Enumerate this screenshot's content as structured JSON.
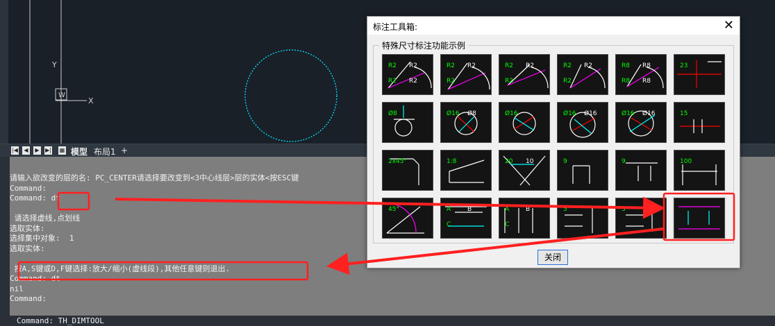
{
  "canvas": {
    "axis_y_label": "Y",
    "axis_x_label": "X",
    "ucs_label": "W",
    "entity_color": "#00e5ff"
  },
  "tabs": {
    "model": "模型",
    "layout1": "布局1",
    "add": "+"
  },
  "command_history": [
    "请输入欲改变的层的名: PC_CENTER请选择要改变到<3中心线层>层的实体<按ESC键",
    "Command:",
    "Command: dt",
    "",
    " 请选择虚线,点划线",
    "选取实体:",
    "选择集中对象:  1",
    "选取实体:",
    "",
    " 按A,S键或D,F键选择:放大/缩小(虚线段),其他任意键则退出.",
    "Command: dt",
    "nil",
    "Command:"
  ],
  "command_prompt": "Command: TH_DIMTOOL",
  "dialog": {
    "title": "标注工具箱:",
    "group_label": "特殊尺寸标注功能示例",
    "close_button": "关闭",
    "tiles": [
      {
        "texts": [
          "R2",
          "R2",
          "R2",
          "R2"
        ]
      },
      {
        "texts": [
          "R2",
          "R2",
          "R2"
        ]
      },
      {
        "texts": [
          "R2",
          "R2",
          "R2"
        ]
      },
      {
        "texts": [
          "R2",
          "R2",
          "R2"
        ]
      },
      {
        "texts": [
          "R8",
          "R8",
          "R8",
          "R8"
        ]
      },
      {
        "texts": [
          "23"
        ]
      },
      {
        "texts": [
          "Ø8"
        ]
      },
      {
        "texts": [
          "Ø16",
          "Ø8"
        ]
      },
      {
        "texts": [
          "Ø16"
        ]
      },
      {
        "texts": [
          "Ø16",
          "Ø16"
        ]
      },
      {
        "texts": [
          "Ø16",
          "Ø16"
        ]
      },
      {
        "texts": [
          "15"
        ]
      },
      {
        "texts": [
          "2x45°"
        ]
      },
      {
        "texts": [
          "1:8"
        ]
      },
      {
        "texts": [
          "20",
          "10"
        ]
      },
      {
        "texts": [
          "9"
        ]
      },
      {
        "texts": [
          "9"
        ]
      },
      {
        "texts": [
          "100"
        ]
      },
      {
        "texts": [
          "45°"
        ]
      },
      {
        "texts": [
          "A",
          "B",
          "C"
        ]
      },
      {
        "texts": [
          "A",
          "B",
          "C"
        ]
      },
      {
        "texts": [
          "5"
        ]
      },
      {
        "texts": [
          "3"
        ]
      },
      {
        "texts": []
      }
    ]
  },
  "annotation_color": "#ff2020"
}
